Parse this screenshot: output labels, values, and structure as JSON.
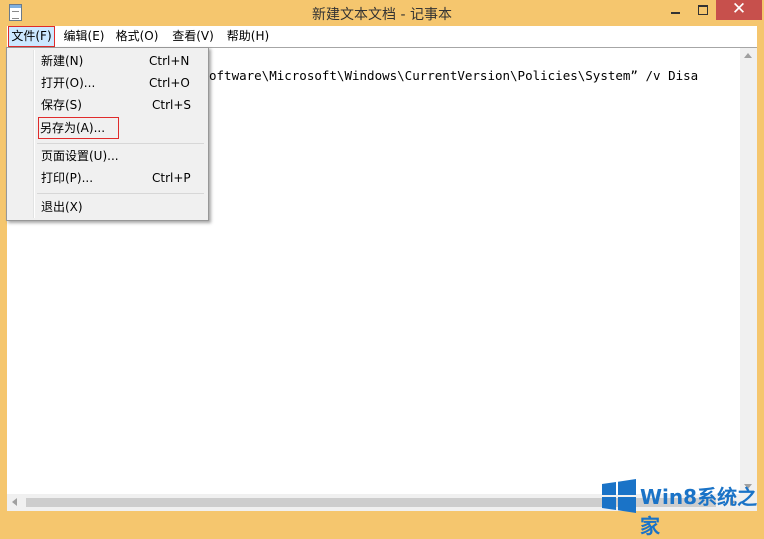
{
  "window": {
    "title": "新建文本文档 - 记事本",
    "minimize_label": "",
    "maximize_label": "",
    "close_label": "✕"
  },
  "menubar": {
    "items": [
      {
        "label": "文件(F)",
        "active": true
      },
      {
        "label": "编辑(E)",
        "active": false
      },
      {
        "label": "格式(O)",
        "active": false
      },
      {
        "label": "查看(V)",
        "active": false
      },
      {
        "label": "帮助(H)",
        "active": false
      }
    ]
  },
  "editor": {
    "visible_text": "oftware\\Microsoft\\Windows\\CurrentVersion\\Policies\\System” /v Disa"
  },
  "file_menu": {
    "items": [
      {
        "label": "新建(N)",
        "shortcut": "Ctrl+N"
      },
      {
        "label": "打开(O)...",
        "shortcut": "Ctrl+O"
      },
      {
        "label": "保存(S)",
        "shortcut": "Ctrl+S"
      },
      {
        "label": "另存为(A)...",
        "shortcut": "",
        "highlighted": true
      },
      {
        "label": "页面设置(U)...",
        "shortcut": ""
      },
      {
        "label": "打印(P)...",
        "shortcut": "Ctrl+P"
      },
      {
        "label": "退出(X)",
        "shortcut": ""
      }
    ]
  },
  "watermark": {
    "text": "Win8系统之家"
  },
  "colors": {
    "title_bar": "#f5c66e",
    "close_button": "#c7504c",
    "annotation_red": "#e02b2b",
    "watermark_blue": "#1a73c7"
  }
}
